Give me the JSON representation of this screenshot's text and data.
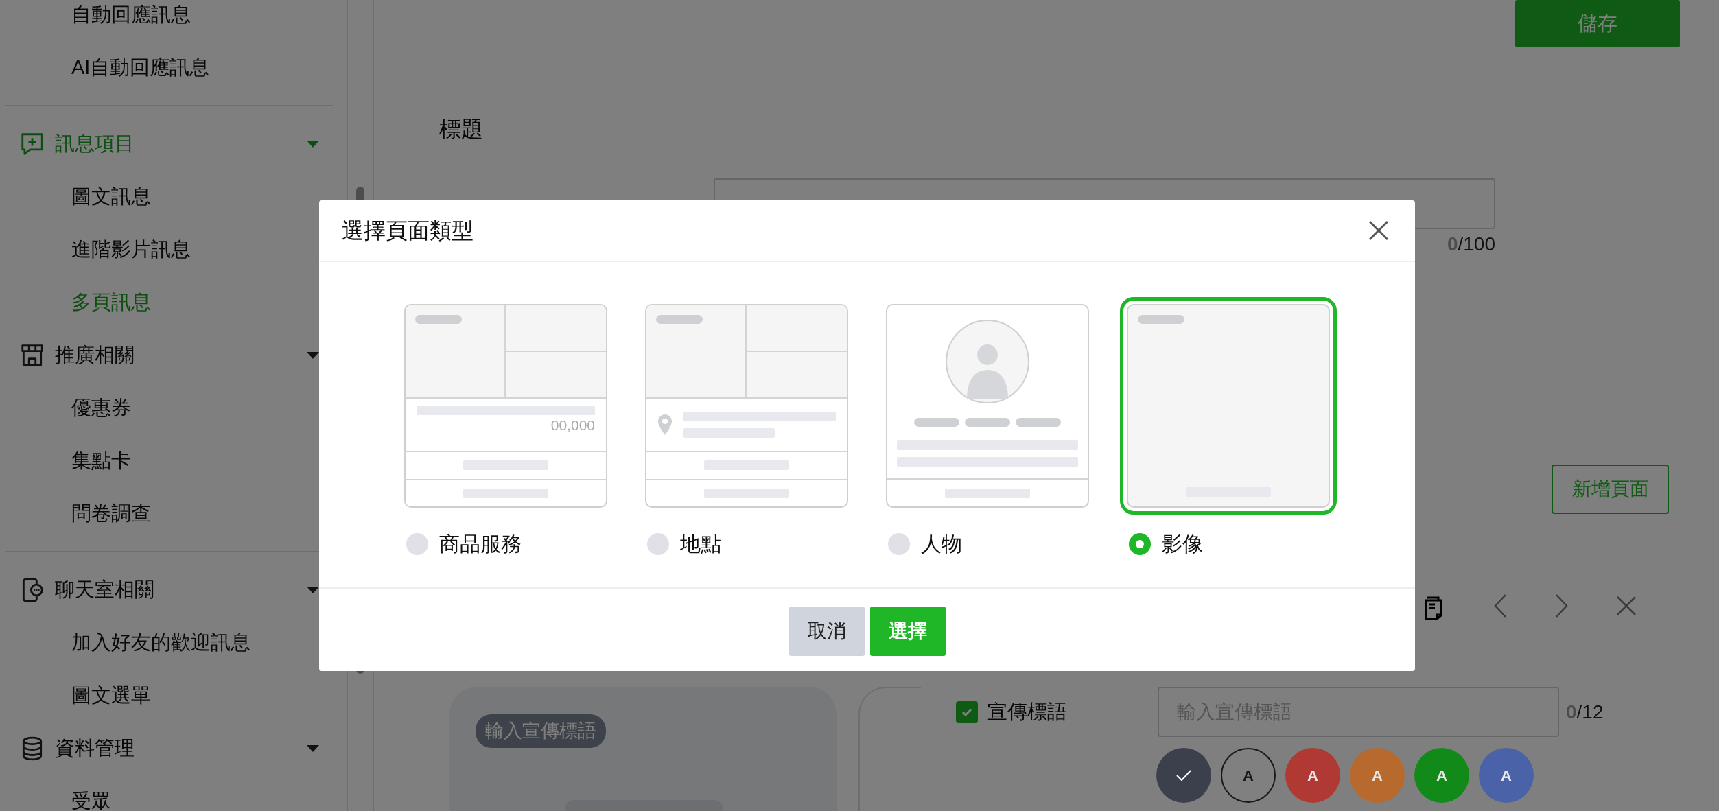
{
  "sidebar": {
    "groups": [
      {
        "sections": [
          {
            "items": [
              {
                "label": "自動回應訊息",
                "selected": false
              },
              {
                "label": "AI自動回應訊息",
                "selected": false
              }
            ]
          }
        ]
      },
      {
        "sections": [
          {
            "kind": "message",
            "title": "訊息項目",
            "selected": true,
            "items": [
              {
                "label": "圖文訊息",
                "selected": false
              },
              {
                "label": "進階影片訊息",
                "selected": false
              },
              {
                "label": "多頁訊息",
                "selected": true
              }
            ]
          },
          {
            "kind": "store",
            "title": "推廣相關",
            "selected": false,
            "items": [
              {
                "label": "優惠券",
                "selected": false
              },
              {
                "label": "集點卡",
                "selected": false
              },
              {
                "label": "問卷調查",
                "selected": false
              }
            ]
          }
        ]
      },
      {
        "sections": [
          {
            "kind": "chat",
            "title": "聊天室相關",
            "selected": false,
            "items": [
              {
                "label": "加入好友的歡迎訊息",
                "selected": false
              },
              {
                "label": "圖文選單",
                "selected": false
              }
            ]
          },
          {
            "kind": "database",
            "title": "資料管理",
            "selected": false,
            "items": [
              {
                "label": "受眾",
                "selected": false
              }
            ]
          }
        ]
      }
    ]
  },
  "save_button": "儲存",
  "title_section": {
    "heading": "標題",
    "counter": "**0**/100"
  },
  "add_page_button": "新增頁面",
  "card_preview": {
    "tag": "輸入宣傳標語"
  },
  "tagline": {
    "label": "宣傳標語",
    "checked": true,
    "input": {
      "placeholder": "輸入宣傳標語"
    },
    "counter": "**0**/12",
    "swatches": [
      {
        "color": "#3c404d",
        "selected": true
      },
      {
        "color": "#808080",
        "selected": false,
        "label": "A"
      },
      {
        "color": "#b03a33",
        "selected": false,
        "label": "A"
      },
      {
        "color": "#b8692e",
        "selected": false,
        "label": "A"
      },
      {
        "color": "#118a19",
        "selected": false,
        "label": "A"
      },
      {
        "color": "#4a63a8",
        "selected": false,
        "label": "A"
      }
    ]
  },
  "modal": {
    "title": "選擇頁面類型",
    "options": [
      {
        "kind": "product",
        "label": "商品服務",
        "selected": false,
        "price": "00,000"
      },
      {
        "kind": "location",
        "label": "地點",
        "selected": false
      },
      {
        "kind": "person",
        "label": "人物",
        "selected": false
      },
      {
        "kind": "image",
        "label": "影像",
        "selected": true
      }
    ],
    "buttons": [
      {
        "kind": "cancel",
        "label": "取消"
      },
      {
        "kind": "confirm",
        "label": "選擇"
      }
    ]
  }
}
